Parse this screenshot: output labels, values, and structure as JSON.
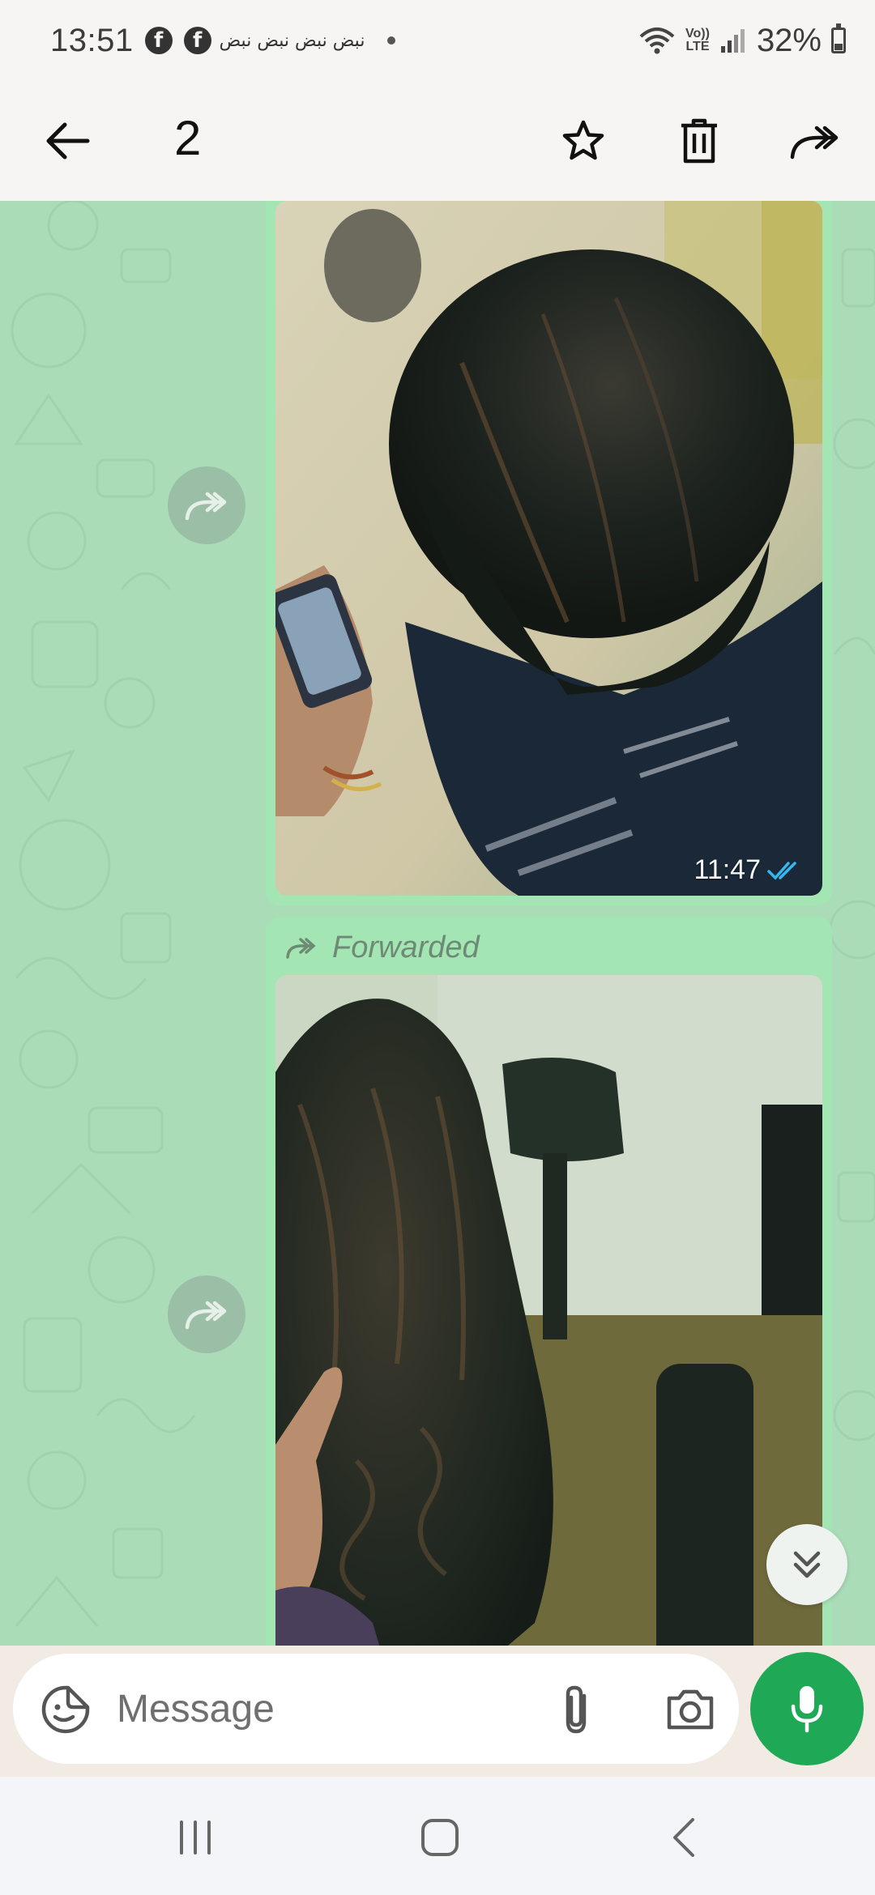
{
  "status_bar": {
    "time": "13:51",
    "notification_text": "نبض نبض نبض نبض",
    "volte_line1": "Vo))",
    "volte_line2": "LTE",
    "battery": "32%"
  },
  "toolbar": {
    "selected_count": "2"
  },
  "messages": [
    {
      "time": "11:47",
      "status": "read"
    },
    {
      "forwarded_label": "Forwarded"
    }
  ],
  "composer": {
    "placeholder": "Message"
  },
  "colors": {
    "chat_bg": "#b5dcc0",
    "bubble": "#a4e5b4",
    "mic": "#1fa855",
    "read_ticks": "#34b7f1"
  }
}
